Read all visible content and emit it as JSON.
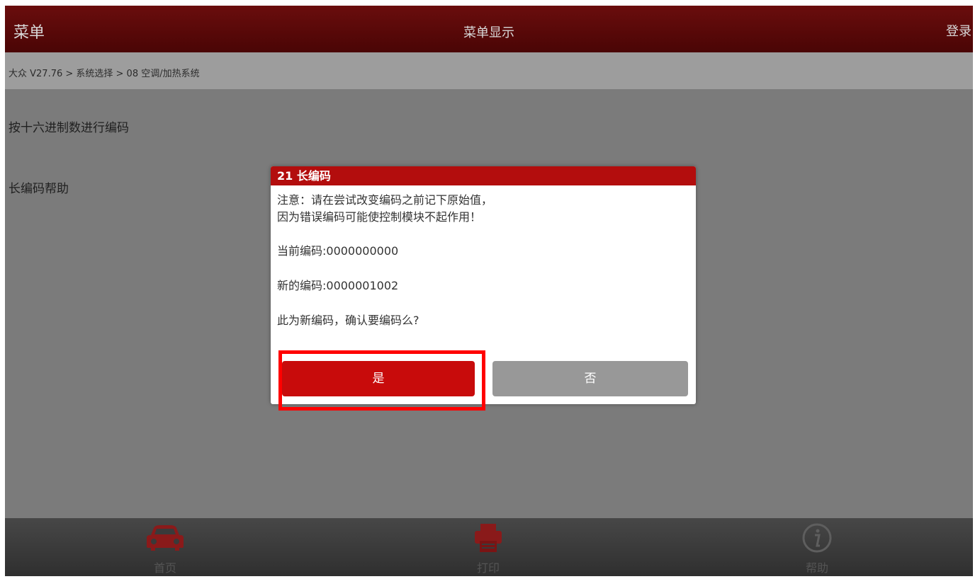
{
  "header": {
    "menu_label": "菜单",
    "title": "菜单显示",
    "login_label": "登录"
  },
  "breadcrumb": "大众 V27.76 > 系统选择 > 08 空调/加热系统",
  "content": {
    "items": [
      {
        "label": "按十六进制数进行编码"
      },
      {
        "label": "长编码帮助"
      }
    ]
  },
  "dialog": {
    "title": "21 长编码",
    "warning_line1": "注意：请在尝试改变编码之前记下原始值，",
    "warning_line2": "因为错误编码可能使控制模块不起作用！",
    "current_code": "当前编码:0000000000",
    "new_code": "新的编码:0000001002",
    "confirm": "此为新编码，确认要编码么?",
    "yes_label": "是",
    "no_label": "否"
  },
  "bottom_nav": [
    {
      "label": "首页",
      "icon": "car-icon"
    },
    {
      "label": "打印",
      "icon": "printer-icon"
    },
    {
      "label": "帮助",
      "icon": "info-icon"
    }
  ],
  "colors": {
    "header_bg": "#5a0909",
    "dialog_header": "#b30d0d",
    "yes_button": "#c80b0b",
    "no_button": "#989898",
    "highlight_frame": "#ff0000"
  }
}
